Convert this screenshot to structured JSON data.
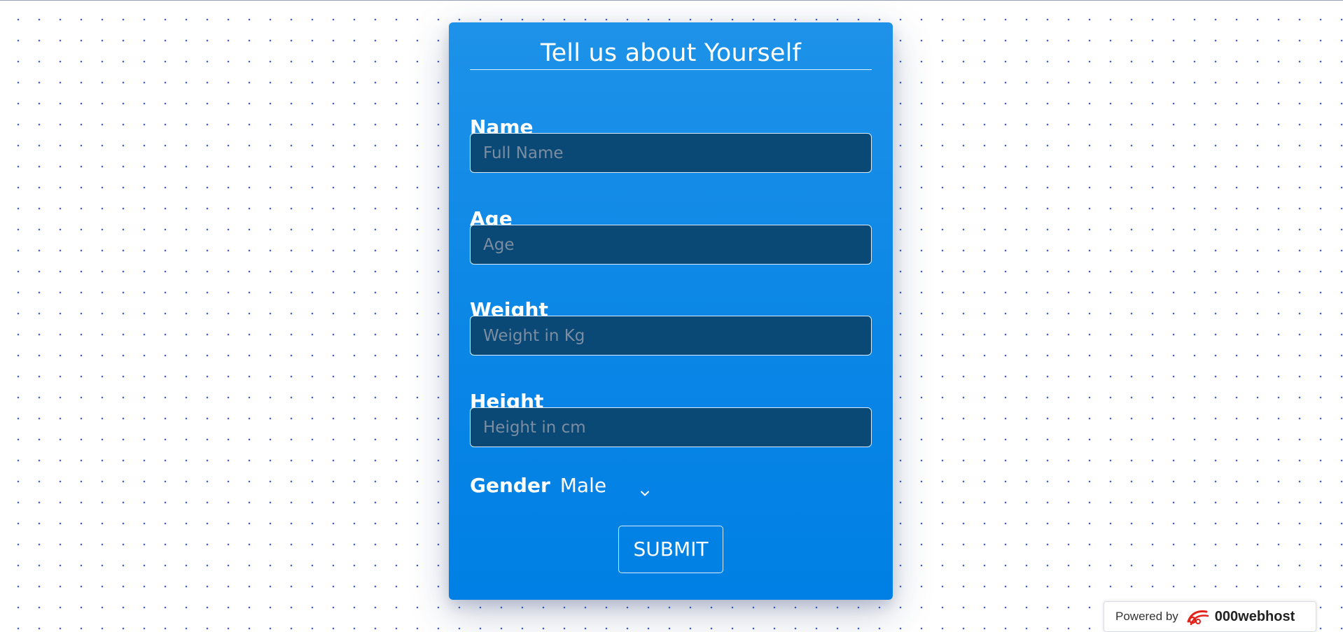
{
  "form": {
    "title": "Tell us about Yourself",
    "fields": [
      {
        "label": "Name",
        "placeholder": "Full Name",
        "value": ""
      },
      {
        "label": "Age",
        "placeholder": "Age",
        "value": ""
      },
      {
        "label": "Weight",
        "placeholder": "Weight in Kg",
        "value": ""
      },
      {
        "label": "Height",
        "placeholder": "Height in cm",
        "value": ""
      }
    ],
    "gender": {
      "label": "Gender",
      "selected": "Male"
    },
    "submit_label": "SUBMIT"
  },
  "footer": {
    "powered_by": "Powered by",
    "brand": "000webhost"
  },
  "colors": {
    "card_top": "#1e92e8",
    "card_bottom": "#0080e4",
    "input_bg": "#0a4876",
    "placeholder": "#7b8da1",
    "dot_pattern": "#3f63d6",
    "brand_red": "#e2231a"
  },
  "icons": {
    "gender_dropdown": "chevron-down-icon",
    "brand_logo": "000webhost-logo-icon"
  }
}
